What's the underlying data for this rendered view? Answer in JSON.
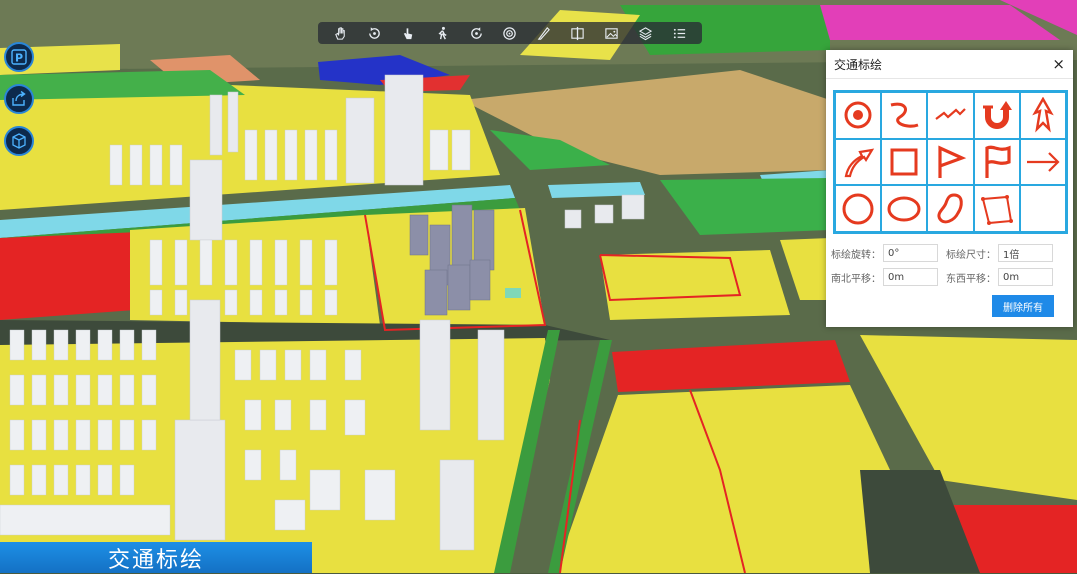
{
  "toolbar": {
    "buttons": [
      {
        "name": "pan-icon"
      },
      {
        "name": "rotate-icon"
      },
      {
        "name": "select-icon"
      },
      {
        "name": "walk-icon"
      },
      {
        "name": "fly-icon"
      },
      {
        "name": "target-icon"
      },
      {
        "name": "measure-icon"
      },
      {
        "name": "split-icon"
      },
      {
        "name": "image-icon"
      },
      {
        "name": "layers-icon"
      },
      {
        "name": "list-icon"
      }
    ]
  },
  "side_buttons": [
    {
      "name": "parking-icon"
    },
    {
      "name": "share-icon"
    },
    {
      "name": "cube-icon"
    }
  ],
  "title_bar": {
    "label": "交通标绘"
  },
  "panel": {
    "title": "交通标绘",
    "close": "×",
    "symbols": [
      "target-symbol",
      "s-curve-symbol",
      "zigzag-symbol",
      "u-turn-arrow-symbol",
      "double-arrow-symbol",
      "curved-arrow-symbol",
      "square-symbol",
      "triangle-flag-symbol",
      "flag-symbol",
      "right-arrow-symbol",
      "circle-symbol",
      "ellipse-symbol",
      "freeform-symbol",
      "polygon-symbol"
    ],
    "symbol_color": "#e53a1f",
    "grid_color": "#29a8e0",
    "rotation": {
      "label": "标绘旋转：",
      "value": "0°"
    },
    "size": {
      "label": "标绘尺寸：",
      "value": "1倍"
    },
    "ns_shift": {
      "label": "南北平移：",
      "value": "0m"
    },
    "ew_shift": {
      "label": "东西平移：",
      "value": "0m"
    },
    "clear_label": "删除所有"
  }
}
